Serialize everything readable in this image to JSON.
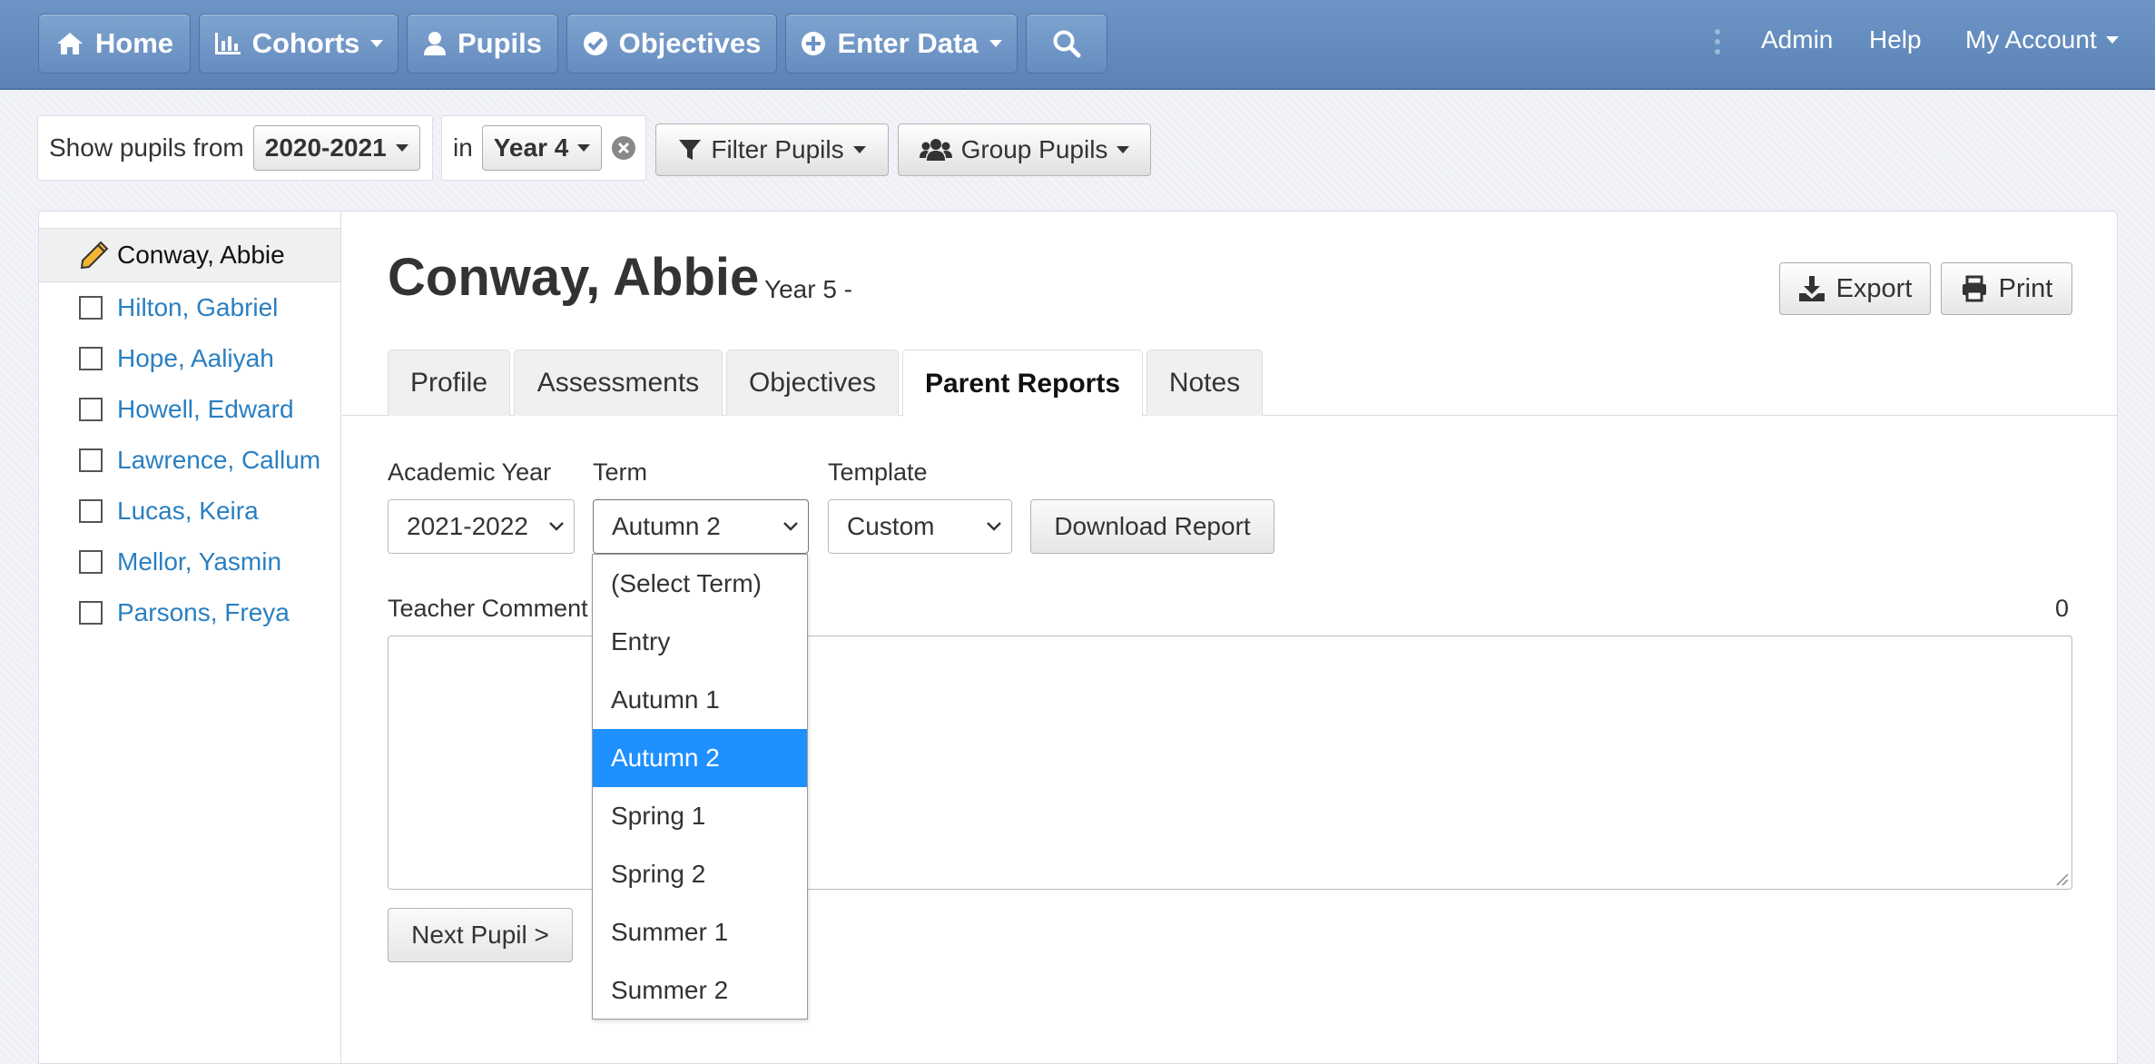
{
  "nav": {
    "home": "Home",
    "cohorts": "Cohorts",
    "pupils": "Pupils",
    "objectives": "Objectives",
    "enter_data": "Enter Data",
    "admin": "Admin",
    "help": "Help",
    "my_account": "My Account"
  },
  "filter": {
    "show_label": "Show pupils from",
    "year_value": "2020-2021",
    "in_label": "in",
    "group_value": "Year 4",
    "filter_label": "Filter Pupils",
    "group_label": "Group Pupils"
  },
  "sidebar": {
    "active": "Conway, Abbie",
    "pupils": [
      "Hilton, Gabriel",
      "Hope, Aaliyah",
      "Howell, Edward",
      "Lawrence, Callum",
      "Lucas, Keira",
      "Mellor, Yasmin",
      "Parsons, Freya"
    ]
  },
  "pupil": {
    "name": "Conway, Abbie",
    "year": "Year 5 -"
  },
  "actions": {
    "export": "Export",
    "print": "Print"
  },
  "tabs": [
    "Profile",
    "Assessments",
    "Objectives",
    "Parent Reports",
    "Notes"
  ],
  "active_tab": "Parent Reports",
  "report": {
    "academic_year_label": "Academic Year",
    "academic_year_value": "2021-2022",
    "term_label": "Term",
    "term_value": "Autumn 2",
    "template_label": "Template",
    "template_value": "Custom",
    "download_label": "Download Report",
    "comment_label": "Teacher Comment",
    "comment_count": "0",
    "next_label": "Next Pupil >"
  },
  "term_options": [
    "(Select Term)",
    "Entry",
    "Autumn 1",
    "Autumn 2",
    "Spring 1",
    "Spring 2",
    "Summer 1",
    "Summer 2"
  ],
  "term_selected": "Autumn 2",
  "colors": {
    "nav": "#6389bb",
    "link": "#2a7fc1",
    "selected_option": "#1e90ff"
  }
}
